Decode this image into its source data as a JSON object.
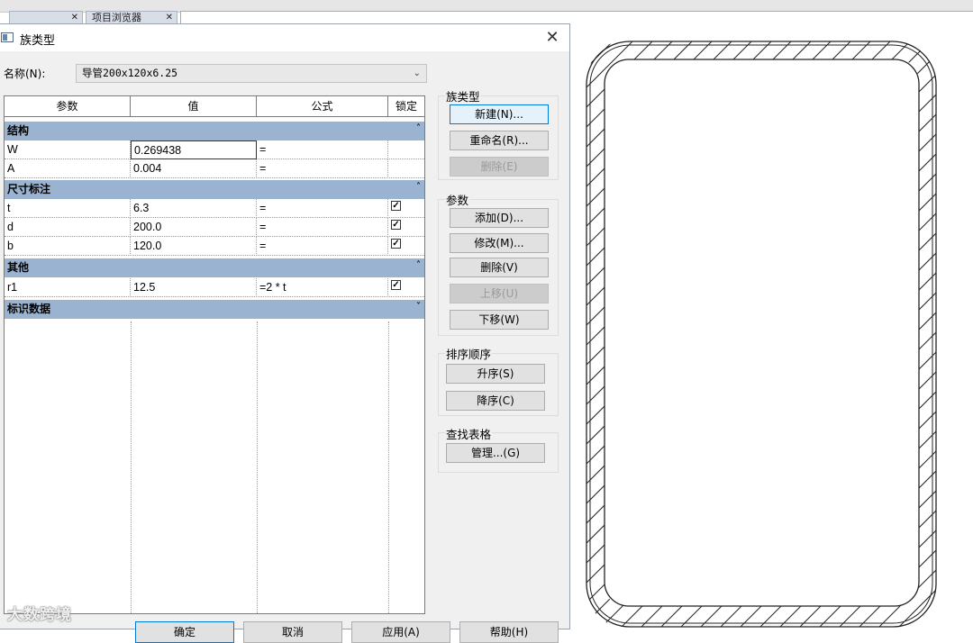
{
  "app": {
    "tab1_label": "",
    "tab2_label": "项目浏览器",
    "tab_close": "✕"
  },
  "dialog": {
    "title": "族类型",
    "close_glyph": "✕",
    "name_label": "名称(N):",
    "name_value": "导管200x120x6.25",
    "table": {
      "headers": [
        "参数",
        "值",
        "公式",
        "锁定"
      ],
      "groups": [
        {
          "label": "结构",
          "chevron": "˄"
        },
        {
          "label": "尺寸标注",
          "chevron": "˄"
        },
        {
          "label": "其他",
          "chevron": "˄"
        },
        {
          "label": "标识数据",
          "chevron": "˅"
        }
      ],
      "rows": [
        {
          "param": "W",
          "value": "0.269438",
          "formula": "=",
          "locked": ""
        },
        {
          "param": "A",
          "value": "0.004",
          "formula": "=",
          "locked": ""
        },
        {
          "param": "t",
          "value": "6.3",
          "formula": "=",
          "locked": "✓"
        },
        {
          "param": "d",
          "value": "200.0",
          "formula": "=",
          "locked": "✓"
        },
        {
          "param": "b",
          "value": "120.0",
          "formula": "=",
          "locked": "✓"
        },
        {
          "param": "r1",
          "value": "12.5",
          "formula": "=2 * t",
          "locked": "✓"
        }
      ]
    },
    "panels": {
      "family_types": {
        "title": "族类型",
        "new": "新建(N)...",
        "rename": "重命名(R)...",
        "delete": "删除(E)"
      },
      "parameters": {
        "title": "参数",
        "add": "添加(D)...",
        "modify": "修改(M)...",
        "remove": "删除(V)",
        "move_up": "上移(U)",
        "move_down": "下移(W)"
      },
      "sort": {
        "title": "排序顺序",
        "ascending": "升序(S)",
        "descending": "降序(C)"
      },
      "lookup": {
        "title": "查找表格",
        "manage": "管理...(G)"
      }
    },
    "bottom_buttons": {
      "ok": "确定",
      "cancel": "取消",
      "apply": "应用(A)",
      "help": "帮助(H)"
    }
  },
  "watermark": "大数跨境",
  "colors": {
    "group_header": "#99b3d1",
    "dialog_bg": "#f0f0f0",
    "focus_border": "#0078d7"
  }
}
